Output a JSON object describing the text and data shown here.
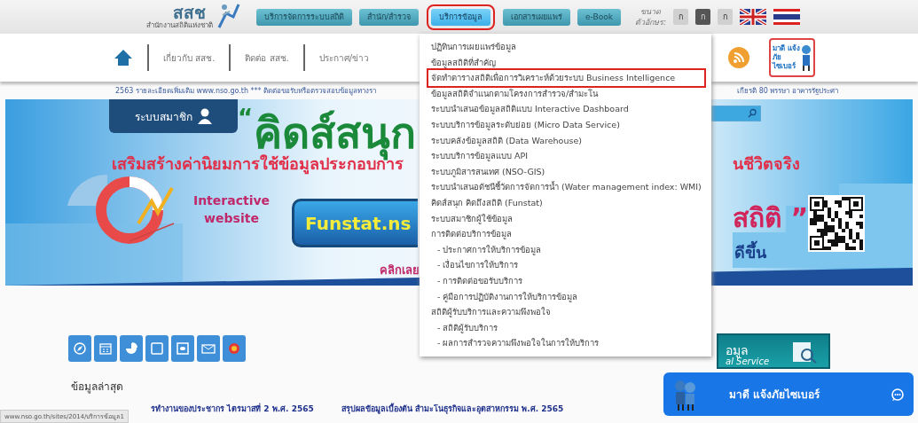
{
  "header": {
    "logo": {
      "name": "สสช",
      "subtitle": "สำนักงานสถิติแห่งชาติ"
    },
    "menu_buttons": [
      {
        "label": "บริการจัดการระบบสถิติ",
        "selected": false
      },
      {
        "label": "สำนัก/สำรวจ",
        "selected": false
      },
      {
        "label": "บริการข้อมูล",
        "selected": true
      },
      {
        "label": "เอกสารเผยแพร่",
        "selected": false
      },
      {
        "label": "e-Book",
        "selected": false
      }
    ],
    "font_size": {
      "label_1": "ขนาด",
      "label_2": "ตัวอักษร:",
      "options": [
        {
          "label": "ก",
          "selected": false
        },
        {
          "label": "ก",
          "selected": true
        },
        {
          "label": "ก",
          "selected": false
        }
      ]
    }
  },
  "nav": {
    "items": [
      "เกี่ยวกับ สสช.",
      "ติดต่อ สสช.",
      "ประกาศ/ข่าว"
    ],
    "mascot_label": "มาดี แจ้งภัย ไซเบอร์"
  },
  "ticker": {
    "left": "2563 รายละเอียดเพิ่มเติม www.nso.go.th *** ติดต่อขอรับหรือตรวจสอบข้อมูลทางรา",
    "right": "เกียรติ 80 พรรษา อาคารรัฐประศา"
  },
  "banner": {
    "member_button": "ระบบสมาชิก",
    "quote_open": "“",
    "title": "คิดส์สนุก",
    "headline": "เสริมสร้างค่านิยมการใช้ข้อมูลประกอบการ",
    "headline_end": "นชีวิตจริง",
    "tagline": "Interactive website",
    "site_button": "Funstat.ns",
    "click": "คลิกเลย",
    "title_end": "สถิติ ”",
    "subtitle_end": "ดีขึ้น"
  },
  "dropdown": {
    "items": [
      {
        "label": "ปฏิทินการเผยแพร่ข้อมูล",
        "highlighted": false
      },
      {
        "label": "ข้อมูลสถิติที่สำคัญ",
        "highlighted": false
      },
      {
        "label": "จัดทำตารางสถิติเพื่อการวิเคราะห์ด้วยระบบ Business Intelligence",
        "highlighted": true
      },
      {
        "label": "ข้อมูลสถิติจำแนกตามโครงการสำรวจ/สำมะโน",
        "highlighted": false
      },
      {
        "label": "ระบบนำเสนอข้อมูลสถิติแบบ Interactive Dashboard",
        "highlighted": false
      },
      {
        "label": "ระบบบริการข้อมูลระดับย่อย (Micro Data Service)",
        "highlighted": false
      },
      {
        "label": "ระบบคลังข้อมูลสถิติ (Data Warehouse)",
        "highlighted": false
      },
      {
        "label": "ระบบบริการข้อมูลแบบ API",
        "highlighted": false
      },
      {
        "label": "ระบบภูมิสารสนเทศ (NSO-GIS)",
        "highlighted": false
      },
      {
        "label": "ระบบนำเสนอดัชนีชี้วัดการจัดการน้ำ (Water management index: WMI)",
        "highlighted": false
      },
      {
        "label": "คิดส์สนุก คิดถึงสถิติ (Funstat)",
        "highlighted": false
      },
      {
        "label": "ระบบสมาชิกผู้ใช้ข้อมูล",
        "highlighted": false
      },
      {
        "label": "การติดต่อบริการข้อมูล",
        "highlighted": false,
        "children": [
          {
            "label": "- ประกาศการให้บริการข้อมูล",
            "highlighted": false
          },
          {
            "label": "- เงื่อนไขการให้บริการ",
            "highlighted": false
          },
          {
            "label": "- การติดต่อขอรับบริการ",
            "highlighted": false
          },
          {
            "label": "- คู่มือการปฏิบัติงานการให้บริการข้อมูล",
            "highlighted": false
          }
        ]
      },
      {
        "label": "สถิติผู้รับบริการและความพึงพอใจ",
        "highlighted": false,
        "children": [
          {
            "label": "- สถิติผู้รับบริการ",
            "highlighted": false
          },
          {
            "label": "- ผลการสำรวจความพึงพอใจในการให้บริการ",
            "highlighted": false
          }
        ]
      }
    ]
  },
  "latest": {
    "title": "ข้อมูลล่าสุด",
    "news": [
      "รทำงานของประชากร ไตรมาสที่ 2 พ.ศ. 2565",
      "สรุปผลข้อมูลเบื้องต้น สำมะโนธุรกิจและอุตสาหกรรม พ.ศ. 2565"
    ]
  },
  "service_card": {
    "title": "อมูล",
    "subtitle": "al Service"
  },
  "chat": {
    "label": "มาดี แจ้งภัยไซเบอร์"
  },
  "status_bar": {
    "url": "www.nso.go.th/sites/2014/บริการข้อมูล1"
  }
}
